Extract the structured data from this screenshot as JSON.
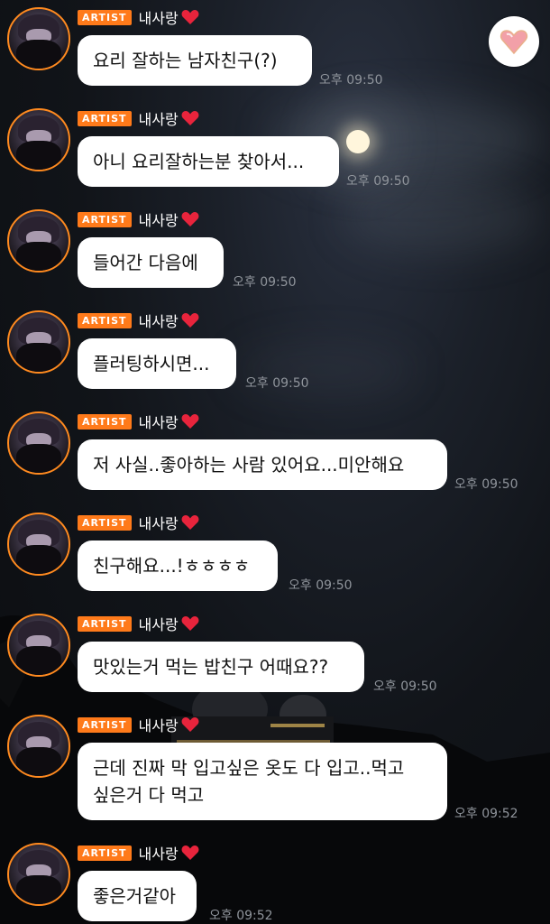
{
  "header": {
    "favorite_icon": "heart-gem-icon"
  },
  "sender": {
    "badge": "ARTIST",
    "name": "내사랑",
    "heart_icon": "red-heart-icon",
    "accent_color": "#ff7a1a"
  },
  "messages": [
    {
      "text": "요리 잘하는 남자친구(?)",
      "time": "오후 09:50"
    },
    {
      "text": "아니 요리잘하는분 찾아서...",
      "time": "오후 09:50"
    },
    {
      "text": "들어간 다음에",
      "time": "오후 09:50"
    },
    {
      "text": "플러팅하시면...",
      "time": "오후 09:50"
    },
    {
      "text": "저 사실..좋아하는 사람 있어요...미안해요",
      "time": "오후 09:50"
    },
    {
      "text": "친구해요...!ㅎㅎㅎㅎ",
      "time": "오후 09:50"
    },
    {
      "text": "맛있는거 먹는 밥친구 어때요??",
      "time": "오후 09:50"
    },
    {
      "text_line1": "근데 진짜 막 입고싶은 옷도 다 입고..먹고",
      "text_line2": "싶은거 다 먹고",
      "time": "오후 09:52"
    },
    {
      "text": "좋은거같아",
      "time": "오후 09:52"
    }
  ]
}
